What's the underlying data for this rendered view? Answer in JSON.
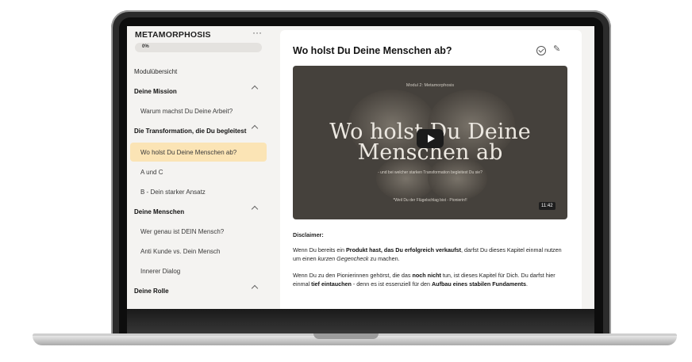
{
  "sidebar": {
    "course_title": "METAMORPHOSIS",
    "menu_label": "···",
    "progress_label": "0%",
    "overview": "Modulübersicht",
    "items": [
      {
        "label": "Deine Mission",
        "type": "section"
      },
      {
        "label": "Warum machst Du Deine Arbeit?",
        "type": "lesson"
      },
      {
        "label": "Die Transformation, die Du begleitest",
        "type": "section"
      },
      {
        "label": "Wo holst Du Deine Menschen ab?",
        "type": "lesson",
        "active": true
      },
      {
        "label": "A und C",
        "type": "lesson"
      },
      {
        "label": "B - Dein starker Ansatz",
        "type": "lesson"
      },
      {
        "label": "Deine Menschen",
        "type": "section"
      },
      {
        "label": "Wer genau ist DEIN Mensch?",
        "type": "lesson"
      },
      {
        "label": "Anti Kunde vs. Dein Mensch",
        "type": "lesson"
      },
      {
        "label": "Innerer Dialog",
        "type": "lesson"
      },
      {
        "label": "Deine Rolle",
        "type": "section"
      }
    ]
  },
  "lesson": {
    "title": "Wo holst Du Deine Menschen ab?",
    "icons": [
      "check-circle-icon",
      "pencil-icon"
    ],
    "video": {
      "module_label": "Modul 2: Metamorphosis",
      "title_line1": "Wo holst Du Deine",
      "title_line2": "Menschen ab",
      "subtitle": "- und bei welcher starken Transformation begleitest Du sie?",
      "quote": "*Weil Du der Flügelschlag bist - Pionierin!!",
      "duration": "11:42"
    },
    "disclaimer_heading": "Disclaimer:",
    "p1": {
      "a": "Wenn Du bereits ein ",
      "b": "Produkt hast, das Du erfolgreich verkaufst",
      "c": ", darfst Du dieses Kapitel einmal nutzen um einen ",
      "d": "kurzen Gegencheck",
      "e": " zu machen."
    },
    "p2": {
      "a": "Wenn Du zu den Pionierinnen gehörst, die das ",
      "b": "noch nicht",
      "c": " tun, ist dieses Kapitel für Dich. Du darfst hier einmal ",
      "d": "tief eintauchen",
      "e": " - denn es ist essenziell für den ",
      "f": "Aufbau eines stabilen Fundaments",
      "g": "."
    }
  },
  "colors": {
    "active_item_bg": "#fbe4b5",
    "video_bg": "#45413c",
    "page_bg": "#f4f3f1"
  }
}
